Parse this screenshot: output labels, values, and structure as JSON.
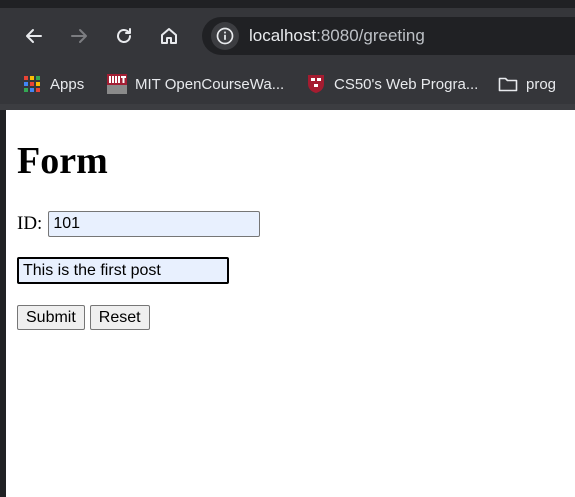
{
  "browser": {
    "url_host": "localhost",
    "url_rest": ":8080/greeting"
  },
  "bookmarks": [
    {
      "label": "Apps",
      "icon": "apps-grid-icon"
    },
    {
      "label": "MIT OpenCourseWa...",
      "icon": "mit-ocw-icon"
    },
    {
      "label": "CS50's Web Progra...",
      "icon": "harvard-shield-icon"
    },
    {
      "label": "prog",
      "icon": "folder-icon"
    }
  ],
  "page": {
    "heading": "Form",
    "id_label": "ID:",
    "id_value": "101",
    "post_value": "This is the first post",
    "submit_label": "Submit",
    "reset_label": "Reset"
  },
  "colors": {
    "toolbar": "#35363a",
    "omnibox": "#202124",
    "autofill": "#e8f0fe"
  }
}
